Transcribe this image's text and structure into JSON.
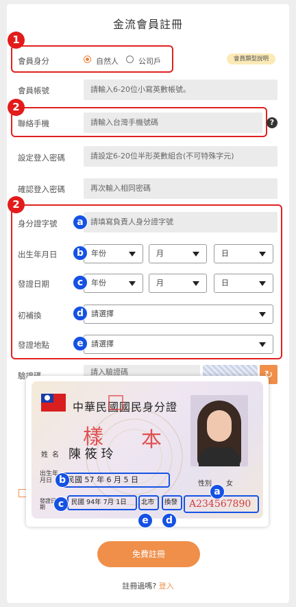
{
  "page_title": "金流會員註冊",
  "member_type": {
    "label": "會員身分",
    "option_person": "自然人",
    "option_company": "公司戶",
    "selected": "自然人",
    "badge": "會員類型說明"
  },
  "account": {
    "label": "會員帳號",
    "placeholder": "請輸入6-20位小寫英數帳號。"
  },
  "phone": {
    "label": "聯絡手機",
    "placeholder": "請輸入台灣手機號碼"
  },
  "password": {
    "label": "設定登入密碼",
    "placeholder": "請設定6-20位半形英數組合(不可特殊字元)"
  },
  "confirm_password": {
    "label": "確認登入密碼",
    "placeholder": "再次輸入相同密碼"
  },
  "id_number": {
    "label": "身分證字號",
    "placeholder": "請填寫負責人身分證字號"
  },
  "birth_date": {
    "label": "出生年月日",
    "year": "年份",
    "month": "月",
    "day": "日"
  },
  "issue_date": {
    "label": "發證日期",
    "year": "年份",
    "month": "月",
    "day": "日"
  },
  "issue_type": {
    "label": "初補換",
    "value": "請選擇"
  },
  "issue_place": {
    "label": "發證地點",
    "value": "請選擇"
  },
  "captcha": {
    "label": "驗證碼",
    "placeholder": "請入驗證碼"
  },
  "step_markers": {
    "one": "1",
    "two": "2",
    "three": "2"
  },
  "letters": {
    "a": "a",
    "b": "b",
    "c": "c",
    "d": "d",
    "e": "e"
  },
  "id_card": {
    "title": "中華民國國民身分證",
    "watermark_1": "樣",
    "watermark_2": "本",
    "name_label": "姓名",
    "name_value": "陳 筱 玲",
    "birth_label": "出生年月日",
    "birth_value": "民國 57 年 6 月 5 日",
    "gender_label": "性別",
    "gender_value": "女",
    "issue_label": "發證日期",
    "issue_date_value": "民國 94年 7月 1日",
    "issue_place_value": "北市",
    "issue_type_value": "換發",
    "id_number_value": "A234567890"
  },
  "submit": "免費註冊",
  "footer": {
    "question": "註冊過嗎?",
    "login": "登入"
  },
  "colors": {
    "accent": "#ef8f4a",
    "highlight_red": "#e02020",
    "marker_blue": "#1552e4"
  }
}
